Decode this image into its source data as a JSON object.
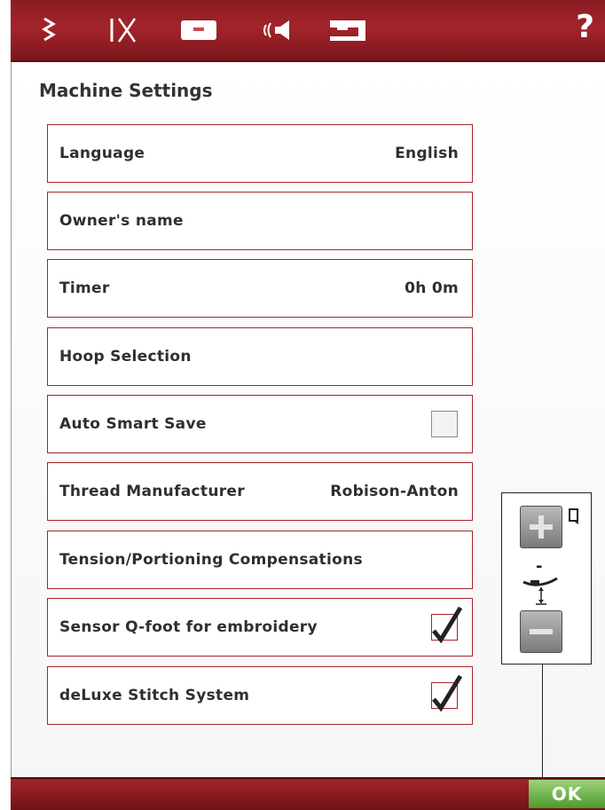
{
  "header": {
    "icons": [
      "stitch-settings-icon",
      "sewing-settings-icon",
      "machine-settings-icon",
      "sound-settings-icon",
      "embroidery-machine-icon"
    ],
    "help_label": "?"
  },
  "page": {
    "title": "Machine Settings"
  },
  "settings": [
    {
      "label": "Language",
      "value": "English"
    },
    {
      "label": "Owner's name",
      "value": ""
    },
    {
      "label": "Timer",
      "value": "0h 0m"
    },
    {
      "label": "Hoop Selection",
      "value": ""
    },
    {
      "label": "Auto Smart Save",
      "checked": false
    },
    {
      "label": "Thread Manufacturer",
      "value": "Robison-Anton"
    },
    {
      "label": "Tension/Portioning Compensations",
      "value": ""
    },
    {
      "label": "Sensor Q-foot for embroidery",
      "checked": true
    },
    {
      "label": "deLuxe Stitch System",
      "checked": true
    }
  ],
  "foot_panel": {
    "level_text": "-"
  },
  "footer": {
    "ok_label": "OK"
  },
  "colors": {
    "accent": "#a3242b",
    "ok_green": "#5fab36"
  }
}
